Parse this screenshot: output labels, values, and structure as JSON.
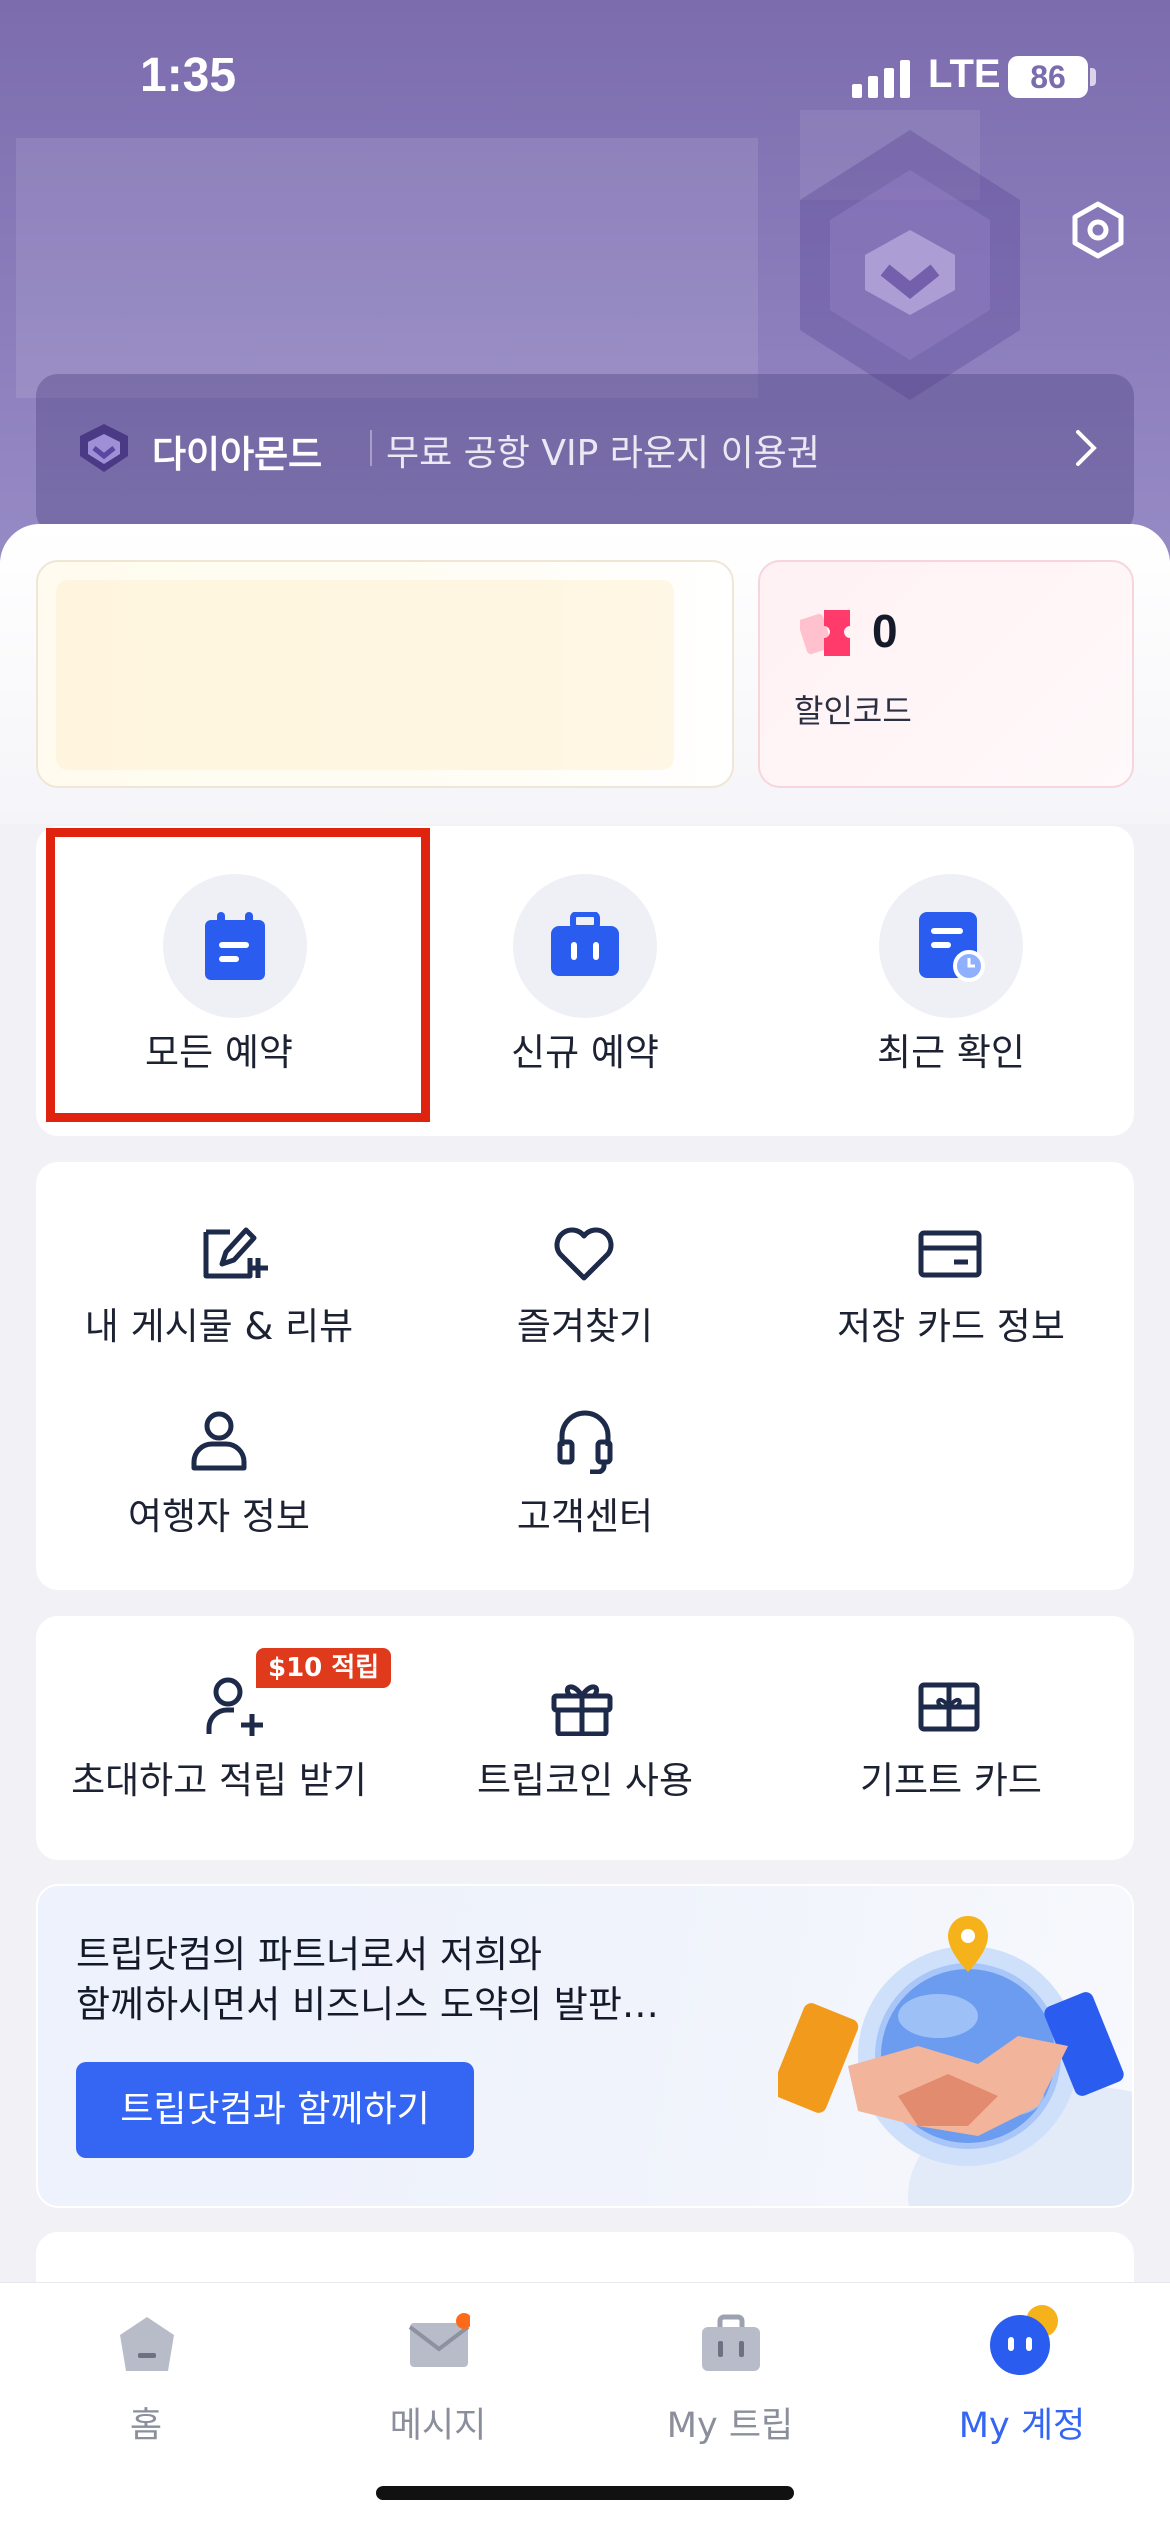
{
  "status_bar": {
    "time": "1:35",
    "network": "LTE",
    "battery": "86"
  },
  "header": {
    "settings_icon": "settings-hexagon-icon",
    "vip": {
      "tier": "다이아몬드",
      "benefit": "무료 공항 VIP 라운지 이용권",
      "icon": "diamond-icon"
    }
  },
  "summary": {
    "coupon_count": "0",
    "coupon_label": "할인코드"
  },
  "booking_shortcuts": [
    {
      "label": "모든 예약",
      "icon": "calendar-icon"
    },
    {
      "label": "신규 예약",
      "icon": "suitcase-icon"
    },
    {
      "label": "최근 확인",
      "icon": "recent-doc-icon"
    }
  ],
  "account_menu": [
    {
      "label": "내 게시물 & 리뷰",
      "icon": "edit-post-icon"
    },
    {
      "label": "즐겨찾기",
      "icon": "heart-icon"
    },
    {
      "label": "저장 카드 정보",
      "icon": "credit-card-icon"
    },
    {
      "label": "여행자 정보",
      "icon": "person-icon"
    },
    {
      "label": "고객센터",
      "icon": "headset-icon"
    }
  ],
  "rewards_menu": [
    {
      "label": "초대하고 적립 받기",
      "icon": "invite-user-icon",
      "badge": "$10 적립"
    },
    {
      "label": "트립코인 사용",
      "icon": "gift-box-icon"
    },
    {
      "label": "기프트 카드",
      "icon": "gift-card-icon"
    }
  ],
  "partner_banner": {
    "line1": "트립닷컴의 파트너로서 저희와",
    "line2": "함께하시면서 비즈니스 도약의 발판…",
    "button": "트립닷컴과 함께하기"
  },
  "bottom_nav": [
    {
      "label": "홈",
      "icon": "home-icon",
      "active": false
    },
    {
      "label": "메시지",
      "icon": "message-icon",
      "active": false
    },
    {
      "label": "My 트립",
      "icon": "trip-bag-icon",
      "active": false
    },
    {
      "label": "My 계정",
      "icon": "account-face-icon",
      "active": true
    }
  ],
  "colors": {
    "accent": "#3565f3",
    "header": "#7c6cae",
    "highlight": "#e0230e",
    "badge": "#e03a1c"
  }
}
